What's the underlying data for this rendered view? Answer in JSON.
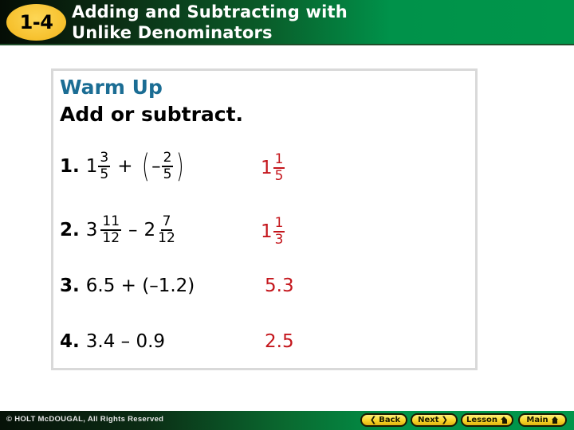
{
  "header": {
    "lesson_number": "1-4",
    "title_line1": "Adding and Subtracting with",
    "title_line2": "Unlike Denominators"
  },
  "content": {
    "heading": "Warm Up",
    "instruction": "Add or subtract.",
    "problems": [
      {
        "number": "1.",
        "whole1": "1",
        "num1": "3",
        "den1": "5",
        "operator": "+",
        "paren_open": "(",
        "sign": "–",
        "num2": "2",
        "den2": "5",
        "paren_close": ")",
        "answer_whole": "1",
        "answer_num": "1",
        "answer_den": "5"
      },
      {
        "number": "2.",
        "whole1": "3",
        "num1": "11",
        "den1": "12",
        "operator": "–",
        "whole2": "2",
        "num2": "7",
        "den2": "12",
        "answer_whole": "1",
        "answer_num": "1",
        "answer_den": "3"
      },
      {
        "number": "3.",
        "expression": "6.5 + (–1.2)",
        "answer": "5.3"
      },
      {
        "number": "4.",
        "expression": "3.4 – 0.9",
        "answer": "2.5"
      }
    ],
    "colors": {
      "heading": "#1b6d94",
      "answer": "#c4161c"
    }
  },
  "footer": {
    "copyright": "© HOLT McDOUGAL, All Rights Reserved",
    "nav": {
      "back_label": "Back",
      "next_label": "Next",
      "lesson_label": "Lesson",
      "main_label": "Main",
      "back_icon": "chevron-left",
      "next_icon": "chevron-right",
      "home_icon": "house"
    }
  }
}
